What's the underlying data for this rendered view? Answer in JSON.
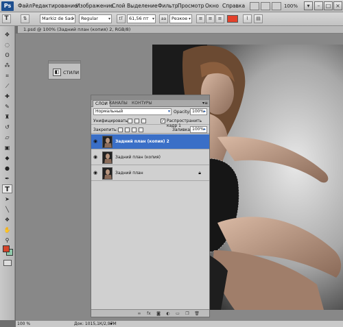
{
  "app": {
    "logo": "Ps"
  },
  "menubar": {
    "items": [
      "Файл",
      "Редактирование",
      "Изображение",
      "Слой",
      "Выделение",
      "Фильтр",
      "Просмотр",
      "Окно",
      "Справка"
    ],
    "zoom": "100%"
  },
  "options": {
    "tool_glyph": "T",
    "font_family": "Markiz de Sad scr...",
    "font_style": "Regular",
    "font_size": "61,56 пт",
    "antialias": "Резкое",
    "text_color": "#e3412b"
  },
  "document": {
    "tab_title": "1.psd @ 100% (Задний план (копия) 2, RGB/8)",
    "zoom": "100 %",
    "doc_info": "Док: 1015,1К/2,97М"
  },
  "styles_panel": {
    "label": "СТИЛИ"
  },
  "layers_panel": {
    "tabs": [
      "СЛОИ",
      "КАНАЛЫ",
      "КОНТУРЫ"
    ],
    "blend_mode": "Нормальный",
    "opacity_label": "Opacity:",
    "opacity": "100%",
    "unify_label": "Унифицировать:",
    "propagate_label": "Распространить кадр 1",
    "lock_label": "Закрепить:",
    "fill_label": "Заливка:",
    "fill": "100%",
    "layers": [
      {
        "name": "Задний план (копия) 2",
        "selected": true,
        "locked": false
      },
      {
        "name": "Задний план (копия)",
        "selected": false,
        "locked": false
      },
      {
        "name": "Задний план",
        "selected": false,
        "locked": true
      }
    ],
    "footer_icons": [
      "link-icon",
      "fx-icon",
      "mask-icon",
      "adjustment-icon",
      "group-icon",
      "new-layer-icon",
      "trash-icon"
    ]
  },
  "colors": {
    "foreground": "#d5452b",
    "background": "#8fc7a9",
    "selection": "#3a6fc7"
  }
}
